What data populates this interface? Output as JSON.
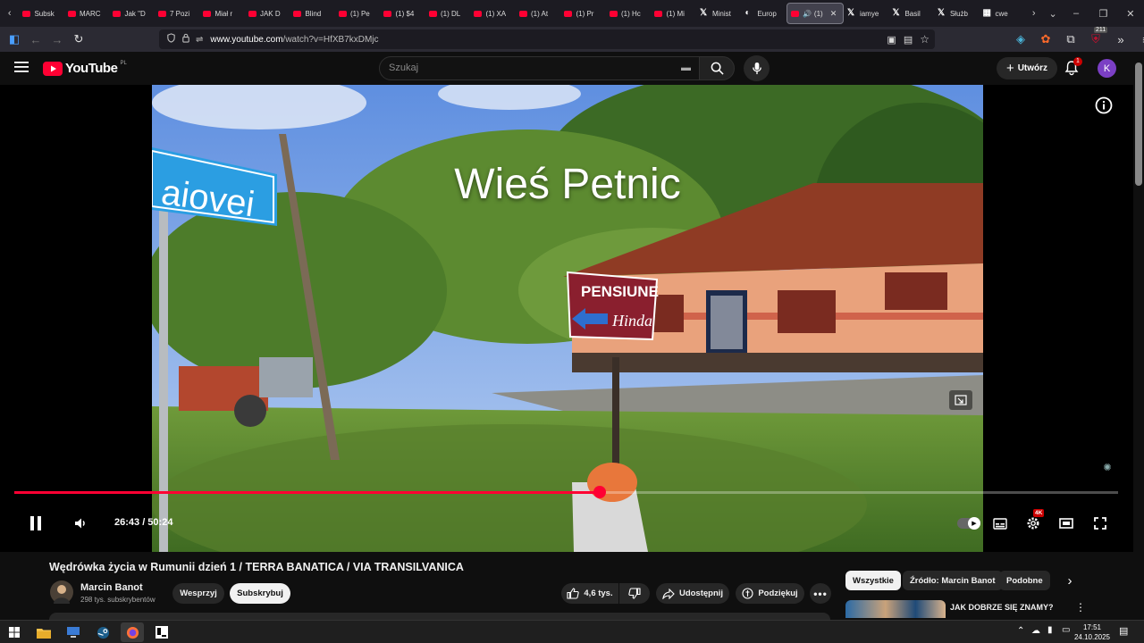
{
  "browser": {
    "tabs": [
      {
        "label": "Subsk",
        "icon": "youtube-icon"
      },
      {
        "label": "MARC",
        "icon": "youtube-icon"
      },
      {
        "label": "Jak \"D",
        "icon": "youtube-icon"
      },
      {
        "label": "7 Pozi",
        "icon": "youtube-icon"
      },
      {
        "label": "Miał r",
        "icon": "youtube-icon"
      },
      {
        "label": "JAK D",
        "icon": "youtube-icon"
      },
      {
        "label": "Blind",
        "icon": "youtube-icon"
      },
      {
        "label": "(1) Pe",
        "icon": "youtube-icon"
      },
      {
        "label": "(1) $4",
        "icon": "youtube-icon"
      },
      {
        "label": "(1) DL",
        "icon": "youtube-icon"
      },
      {
        "label": "(1) XA",
        "icon": "youtube-icon"
      },
      {
        "label": "(1) At",
        "icon": "youtube-icon"
      },
      {
        "label": "(1) Pr",
        "icon": "youtube-icon"
      },
      {
        "label": "(1) Hc",
        "icon": "youtube-icon"
      },
      {
        "label": "(1) Mi",
        "icon": "youtube-icon"
      },
      {
        "label": "Minist",
        "icon": "x-icon"
      },
      {
        "label": "Europ",
        "icon": "globe-icon"
      },
      {
        "label": "(1)",
        "icon": "youtube-icon",
        "active": true
      },
      {
        "label": "iamye",
        "icon": "x-icon"
      },
      {
        "label": "Basil",
        "icon": "x-icon"
      },
      {
        "label": "Służb",
        "icon": "x-icon"
      },
      {
        "label": "cwe",
        "icon": "grid-icon"
      }
    ],
    "url_host": "www.youtube.com",
    "url_path": "/watch?v=HfXB7kxDMjc",
    "extension_badge": "211"
  },
  "youtube": {
    "logo_text": "YouTube",
    "region": "PL",
    "search_placeholder": "Szukaj",
    "create_label": "Utwórz",
    "notifications_count": "1",
    "avatar_letter": "K"
  },
  "player": {
    "overlay_title": "Wieś Petnic",
    "current_time": "26:43",
    "duration": "50:24",
    "time_display": "26:43 / 50:24",
    "progress_fraction": 0.53,
    "quality_badge": "4K"
  },
  "video": {
    "title": "Wędrówka życia w Rumunii dzień 1 / TERRA BANATICA / VIA TRANSILVANICA",
    "channel_name": "Marcin Banot",
    "subscribers": "298 tys. subskrybentów",
    "support_label": "Wesprzyj",
    "subscribe_label": "Subskrybuj",
    "likes": "4,6 tys.",
    "share_label": "Udostępnij",
    "thanks_label": "Podziękuj"
  },
  "sidebar": {
    "chips": [
      "Wszystkie",
      "Źródło: Marcin Banot",
      "Podobne"
    ],
    "rec_title": "JAK DOBRZE SIĘ ZNAMY?"
  },
  "taskbar": {
    "time": "17:51",
    "date": "24.10.2025"
  },
  "colors": {
    "accent": "#ff0033",
    "background": "#0f0f0f",
    "avatar": "#7b3fc4"
  }
}
